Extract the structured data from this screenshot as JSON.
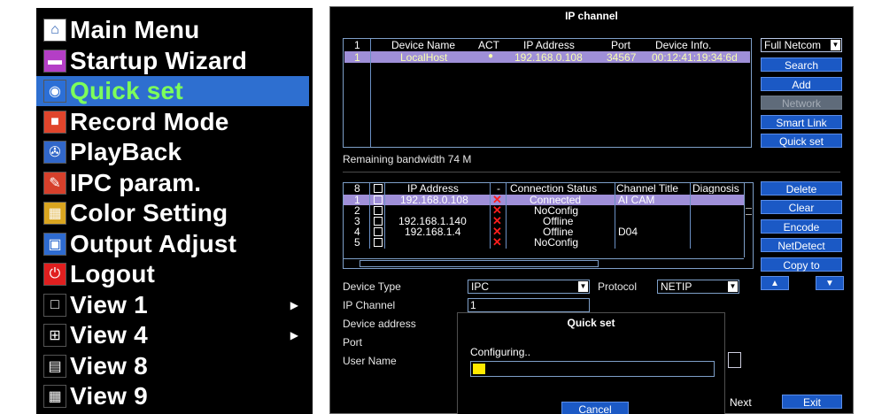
{
  "menu": {
    "items": [
      {
        "label": "Main Menu",
        "icon": "home-icon",
        "glyph": "⌂",
        "icon_bg": "#ffffff",
        "icon_fg": "#2a5fb3"
      },
      {
        "label": "Startup Wizard",
        "icon": "wizard-icon",
        "glyph": "▬",
        "icon_bg": "#b43ec6",
        "icon_fg": "#ffffff"
      },
      {
        "label": "Quick set",
        "icon": "quick-set-icon",
        "glyph": "◉",
        "icon_bg": "#2c6fd6",
        "icon_fg": "#ffffff",
        "selected": true
      },
      {
        "label": "Record Mode",
        "icon": "record-icon",
        "glyph": "■",
        "icon_bg": "#e0452c",
        "icon_fg": "#ffffff"
      },
      {
        "label": "PlayBack",
        "icon": "playback-icon",
        "glyph": "✇",
        "icon_bg": "#3167c9",
        "icon_fg": "#ffffff"
      },
      {
        "label": "IPC param.",
        "icon": "ipc-param-icon",
        "glyph": "✎",
        "icon_bg": "#d6402b",
        "icon_fg": "#ffffff"
      },
      {
        "label": "Color Setting",
        "icon": "color-setting-icon",
        "glyph": "▦",
        "icon_bg": "#d9a520",
        "icon_fg": "#ffffff"
      },
      {
        "label": "Output Adjust",
        "icon": "monitor-icon",
        "glyph": "▣",
        "icon_bg": "#2e6bd0",
        "icon_fg": "#ffffff"
      },
      {
        "label": "Logout",
        "icon": "power-icon",
        "glyph": "⏻",
        "icon_bg": "#e01f1f",
        "icon_fg": "#ffffff"
      },
      {
        "label": "View 1",
        "icon": "view-1-icon",
        "glyph": "□",
        "icon_bg": "#000000",
        "icon_fg": "#ffffff",
        "submenu": true
      },
      {
        "label": "View 4",
        "icon": "view-4-icon",
        "glyph": "⊞",
        "icon_bg": "#000000",
        "icon_fg": "#ffffff",
        "submenu": true
      },
      {
        "label": "View 8",
        "icon": "view-8-icon",
        "glyph": "▤",
        "icon_bg": "#000000",
        "icon_fg": "#ffffff"
      },
      {
        "label": "View 9",
        "icon": "view-9-icon",
        "glyph": "▦",
        "icon_bg": "#000000",
        "icon_fg": "#ffffff"
      }
    ]
  },
  "dialog": {
    "title": "IP channel",
    "device_table": {
      "headers": [
        "1",
        "Device Name",
        "ACT",
        "IP Address",
        "Port",
        "Device Info."
      ],
      "rows": [
        {
          "num": "1",
          "name": "LocalHost",
          "act": "●",
          "ip": "192.168.0.108",
          "port": "34567",
          "info": "00:12:41:19:34:6d"
        }
      ]
    },
    "protocol_filter": "Full Netcom",
    "buttons_top": {
      "search": "Search",
      "add": "Add",
      "network": "Network",
      "smart_link": "Smart Link",
      "quick_set": "Quick set"
    },
    "remaining_bandwidth": "Remaining bandwidth  74 M",
    "channel_table": {
      "headers": [
        "8",
        "IP Address",
        "-",
        "Connection Status",
        "Channel Title",
        "Diagnosis"
      ],
      "rows": [
        {
          "num": "1",
          "ip": "192.168.0.108",
          "status": "Connected",
          "title": "AI CAM"
        },
        {
          "num": "2",
          "ip": "",
          "status": "NoConfig",
          "title": ""
        },
        {
          "num": "3",
          "ip": "192.168.1.140",
          "status": "Offline",
          "title": ""
        },
        {
          "num": "4",
          "ip": "192.168.1.4",
          "status": "Offline",
          "title": "D04"
        },
        {
          "num": "5",
          "ip": "",
          "status": "NoConfig",
          "title": ""
        }
      ]
    },
    "buttons_side": {
      "delete": "Delete",
      "clear": "Clear",
      "encode": "Encode",
      "net_detect": "NetDetect",
      "copy_to": "Copy to",
      "up": "▲",
      "down": "▼"
    },
    "form": {
      "device_type_label": "Device Type",
      "device_type": "IPC",
      "protocol_label": "Protocol",
      "protocol": "NETIP",
      "ip_channel_label": "IP Channel",
      "ip_channel": "1",
      "device_address_label": "Device address",
      "port_label": "Port",
      "user_name_label": "User Name"
    },
    "buttons_bottom": {
      "next": "Next",
      "exit": "Exit"
    }
  },
  "quick_set_popup": {
    "title": "Quick set",
    "message": "Configuring..",
    "progress": 0.05,
    "cancel": "Cancel"
  },
  "colors": {
    "accent": "#1b59c5",
    "selected": "#2e6fd0",
    "highlight_row": "#9f8fd8",
    "progress": "#ffea00",
    "error_x": "#ff1d1d"
  }
}
